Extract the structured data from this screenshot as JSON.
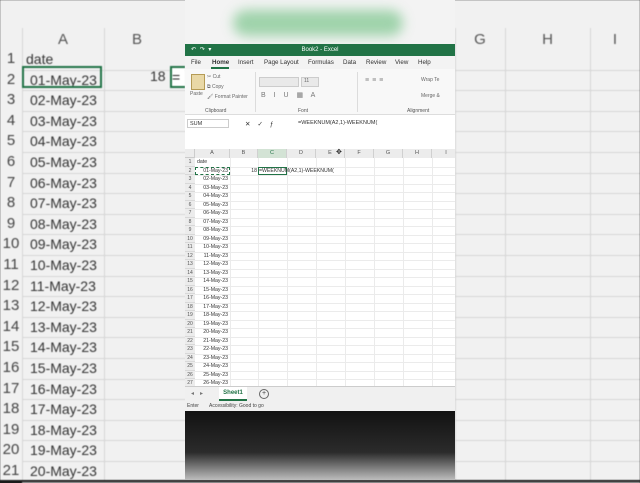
{
  "window": {
    "title": "Book2 - Excel",
    "quick_access": "↶ ↷ ▾"
  },
  "menu": [
    "File",
    "Home",
    "Insert",
    "Page Layout",
    "Formulas",
    "Data",
    "Review",
    "View",
    "Help"
  ],
  "ribbon": {
    "paste": "Paste",
    "cut": "Cut",
    "copy": "Copy",
    "format_painter": "Format Painter",
    "clipboard_group": "Clipboard",
    "font_size": "11",
    "font_group": "Font",
    "wrap_text": "Wrap Te",
    "merge": "Merge &",
    "alignment_group": "Alignment"
  },
  "formula_bar": {
    "name_box": "SUM",
    "formula": "=WEEKNUM(A2,1)-WEEKNUM("
  },
  "columns": [
    "A",
    "B",
    "C",
    "D",
    "E",
    "F",
    "G",
    "H",
    "I"
  ],
  "header_cell": "date",
  "dates": [
    "01-May-23",
    "02-May-23",
    "03-May-23",
    "04-May-23",
    "05-May-23",
    "06-May-23",
    "07-May-23",
    "08-May-23",
    "09-May-23",
    "10-May-23",
    "11-May-23",
    "12-May-23",
    "13-May-23",
    "14-May-23",
    "15-May-23",
    "16-May-23",
    "17-May-23",
    "18-May-23",
    "19-May-23",
    "20-May-23",
    "21-May-23",
    "22-May-23",
    "23-May-23",
    "24-May-23",
    "25-May-23",
    "26-May-23"
  ],
  "cell_b2": "18",
  "cell_c2_editing": "=WEEKNUM(A2,1)-WEEKNUM(",
  "sheet_tab": "Sheet1",
  "status": {
    "mode": "Enter",
    "accessibility": "Accessibility: Good to go"
  },
  "background": {
    "columns": [
      "A",
      "B",
      "G",
      "H",
      "I"
    ],
    "header_cell": "date",
    "b2": "18",
    "c2_fragment": "="
  },
  "colors": {
    "excel_green": "#217346"
  }
}
